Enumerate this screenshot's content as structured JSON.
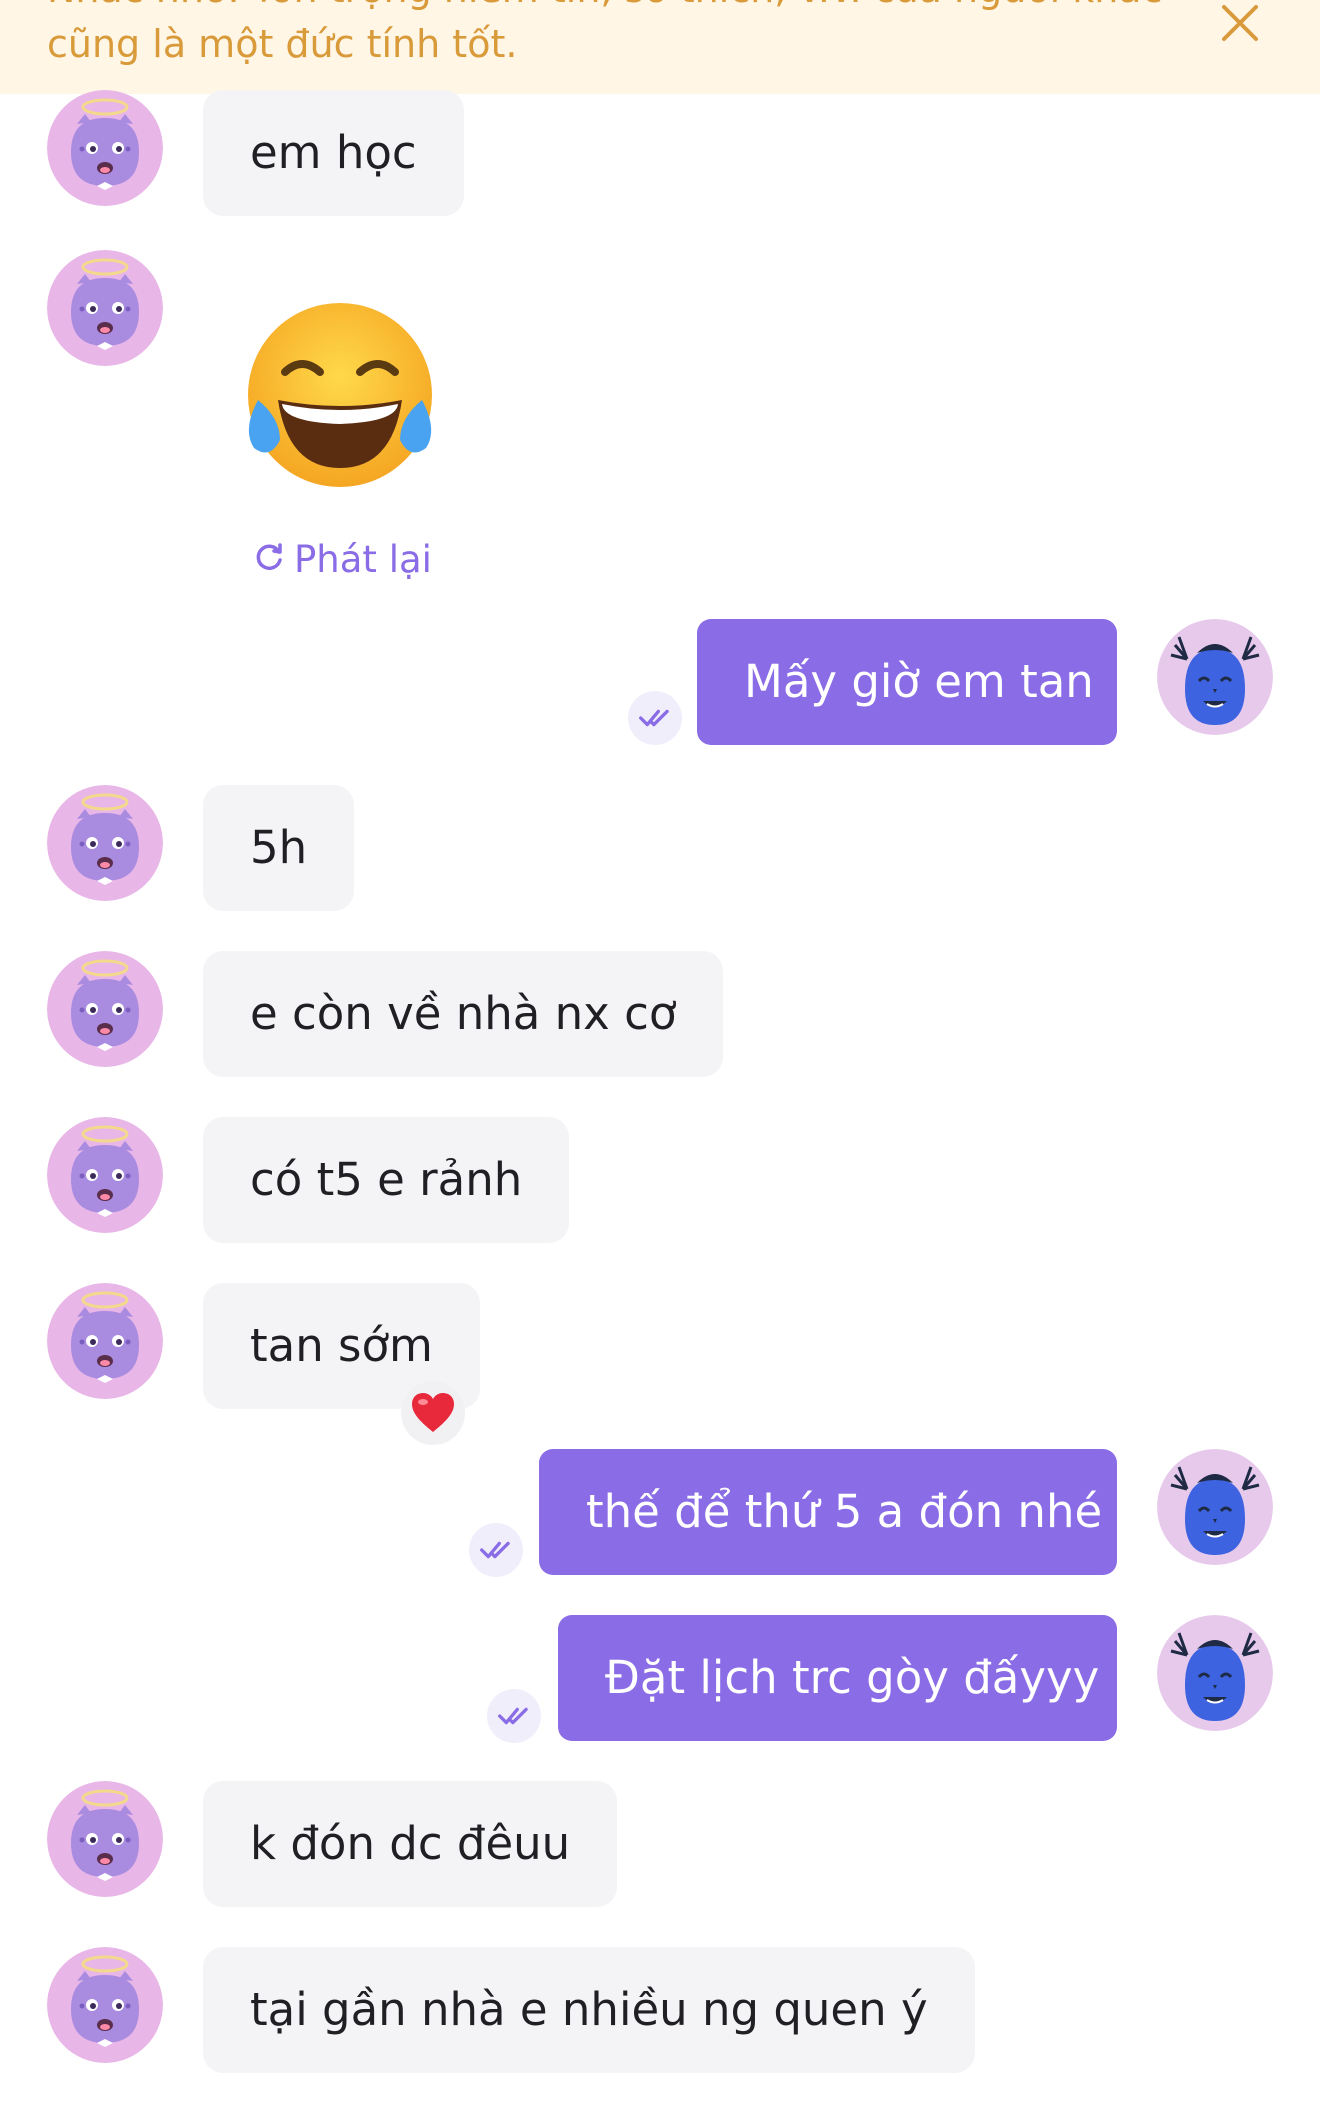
{
  "banner": {
    "text": "Nhắc nhở: Tôn trọng niềm tin, sở thích, v.v. của người khác cũng là một đức tính tốt.",
    "close_icon": "close-icon"
  },
  "colors": {
    "outgoing_bubble": "#8a6ce6",
    "incoming_bubble": "#f4f4f7",
    "banner_bg": "#fff6e6",
    "banner_text": "#d99a3a"
  },
  "messages": [
    {
      "sender": "other",
      "text": "em học"
    },
    {
      "sender": "other",
      "type": "sticker",
      "emoji": "😂",
      "replay_label": "Phát lại"
    },
    {
      "sender": "me",
      "text": "Mấy giờ em tan",
      "status": "read"
    },
    {
      "sender": "other",
      "text": "5h"
    },
    {
      "sender": "other",
      "text": "e còn về nhà nx cơ"
    },
    {
      "sender": "other",
      "text": "có t5 e rảnh"
    },
    {
      "sender": "other",
      "text": "tan sớm",
      "reaction": "❤️"
    },
    {
      "sender": "me",
      "text": "thế để thứ 5 a đón nhé",
      "status": "read"
    },
    {
      "sender": "me",
      "text": "Đặt lịch trc gòy đấyyy",
      "status": "read"
    },
    {
      "sender": "other",
      "text": "k đón dc đêuu"
    },
    {
      "sender": "other",
      "text": "tại gần nhà e nhiều ng quen ý"
    }
  ]
}
